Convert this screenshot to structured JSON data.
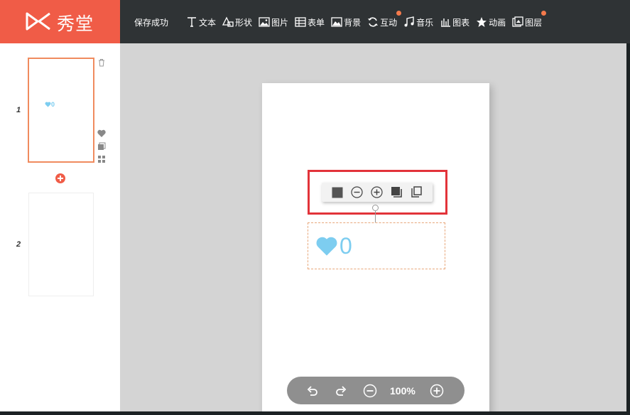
{
  "header": {
    "logo_text": "秀堂",
    "save_status": "保存成功",
    "accent_color": "#f05c47",
    "tools": [
      {
        "label": "文本",
        "icon": "text-icon"
      },
      {
        "label": "形状",
        "icon": "shape-icon"
      },
      {
        "label": "图片",
        "icon": "image-icon"
      },
      {
        "label": "表单",
        "icon": "form-icon"
      },
      {
        "label": "背景",
        "icon": "background-icon"
      },
      {
        "label": "互动",
        "icon": "interact-icon"
      },
      {
        "label": "音乐",
        "icon": "music-icon"
      },
      {
        "label": "图表",
        "icon": "chart-icon"
      },
      {
        "label": "动画",
        "icon": "animation-icon"
      },
      {
        "label": "图层",
        "icon": "layer-icon"
      }
    ]
  },
  "pages": [
    {
      "number": "1",
      "like_count": "0"
    },
    {
      "number": "2"
    }
  ],
  "canvas": {
    "like_count": "0",
    "like_color": "#7dcdf0"
  },
  "zoom": {
    "level": "100%"
  }
}
